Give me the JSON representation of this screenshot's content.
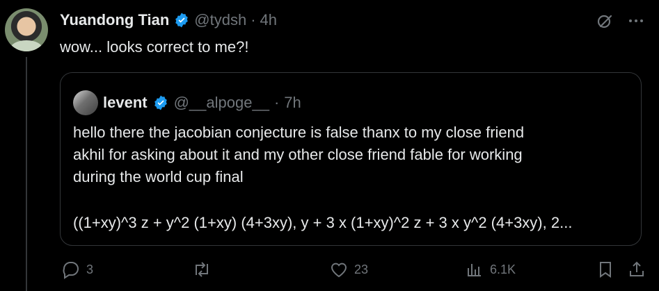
{
  "post": {
    "author": {
      "name": "Yuandong Tian",
      "handle": "@tydsh",
      "time": "4h"
    },
    "text": "wow... looks correct to me?!",
    "quote": {
      "author": {
        "name": "levent",
        "handle": "@__alpoge__",
        "time": "7h"
      },
      "body": "hello there the jacobian conjecture is false thanx to my close friend\nakhil for asking about it and my other close friend fable for working\nduring the world cup final",
      "formula": "((1+xy)^3 z + y^2 (1+xy) (4+3xy), y + 3 x (1+xy)^2  z + 3 x y^2 (4+3xy), 2..."
    },
    "stats": {
      "replies": "3",
      "likes": "23",
      "views": "6.1K"
    }
  },
  "ui": {
    "dot": "·",
    "icons": {
      "verified": "verified-badge-icon",
      "grok": "grok-icon",
      "more": "more-icon",
      "reply": "reply-icon",
      "repost": "repost-icon",
      "like": "heart-icon",
      "views": "views-icon",
      "bookmark": "bookmark-icon",
      "share": "share-icon"
    },
    "colors": {
      "verified": "#1d9bf0",
      "muted": "#71767b",
      "text": "#e7e9ea",
      "border": "#333639"
    }
  }
}
